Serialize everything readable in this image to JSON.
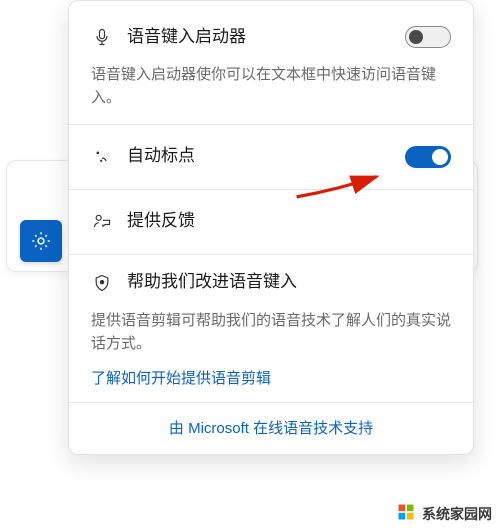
{
  "colors": {
    "accent": "#0a63c2",
    "text": "#1b1b1b",
    "muted": "#6b6b6b",
    "annotation": "#d81e06"
  },
  "items": {
    "launcher": {
      "title": "语音键入启动器",
      "desc": "语音键入启动器使你可以在文本框中快速访问语音键入。",
      "toggle_state": "off"
    },
    "autopunct": {
      "title": "自动标点",
      "toggle_state": "on"
    },
    "feedback": {
      "title": "提供反馈"
    },
    "improve": {
      "title": "帮助我们改进语音键入",
      "desc": "提供语音剪辑可帮助我们的语音技术了解人们的真实说话方式。",
      "link": "了解如何开始提供语音剪辑"
    }
  },
  "footer": {
    "text": "由 Microsoft 在线语音技术支持"
  },
  "watermark": {
    "text": "系统家园网"
  }
}
